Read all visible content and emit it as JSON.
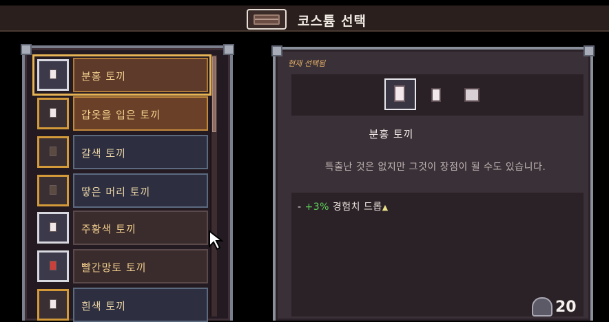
{
  "header": {
    "title": "코스튬 선택",
    "icon": "chest-icon"
  },
  "costumes": [
    {
      "name": "분홍 토끼",
      "state": "selected"
    },
    {
      "name": "갑옷을 입은 토끼",
      "state": "highlight"
    },
    {
      "name": "갈색 토끼",
      "state": "locked"
    },
    {
      "name": "땋은 머리 토끼",
      "state": "locked"
    },
    {
      "name": "주황색 토끼",
      "state": "normal"
    },
    {
      "name": "빨간망토 토끼",
      "state": "normal"
    },
    {
      "name": "흰색 토끼",
      "state": "locked"
    }
  ],
  "detail": {
    "current_label": "현재 선택됨",
    "name": "분홍 토끼",
    "description": "특출난 것은 없지만 그것이 장점이 될 수도 있습니다.",
    "stat_prefix": "- ",
    "stat_value": "+3%",
    "stat_text": " 경험치 드롭",
    "stat_arrow": "▲"
  },
  "currency": {
    "count": "20",
    "icon": "gem-icon"
  },
  "colors": {
    "accent_gold": "#e6b455",
    "stat_green": "#5ed35a"
  }
}
